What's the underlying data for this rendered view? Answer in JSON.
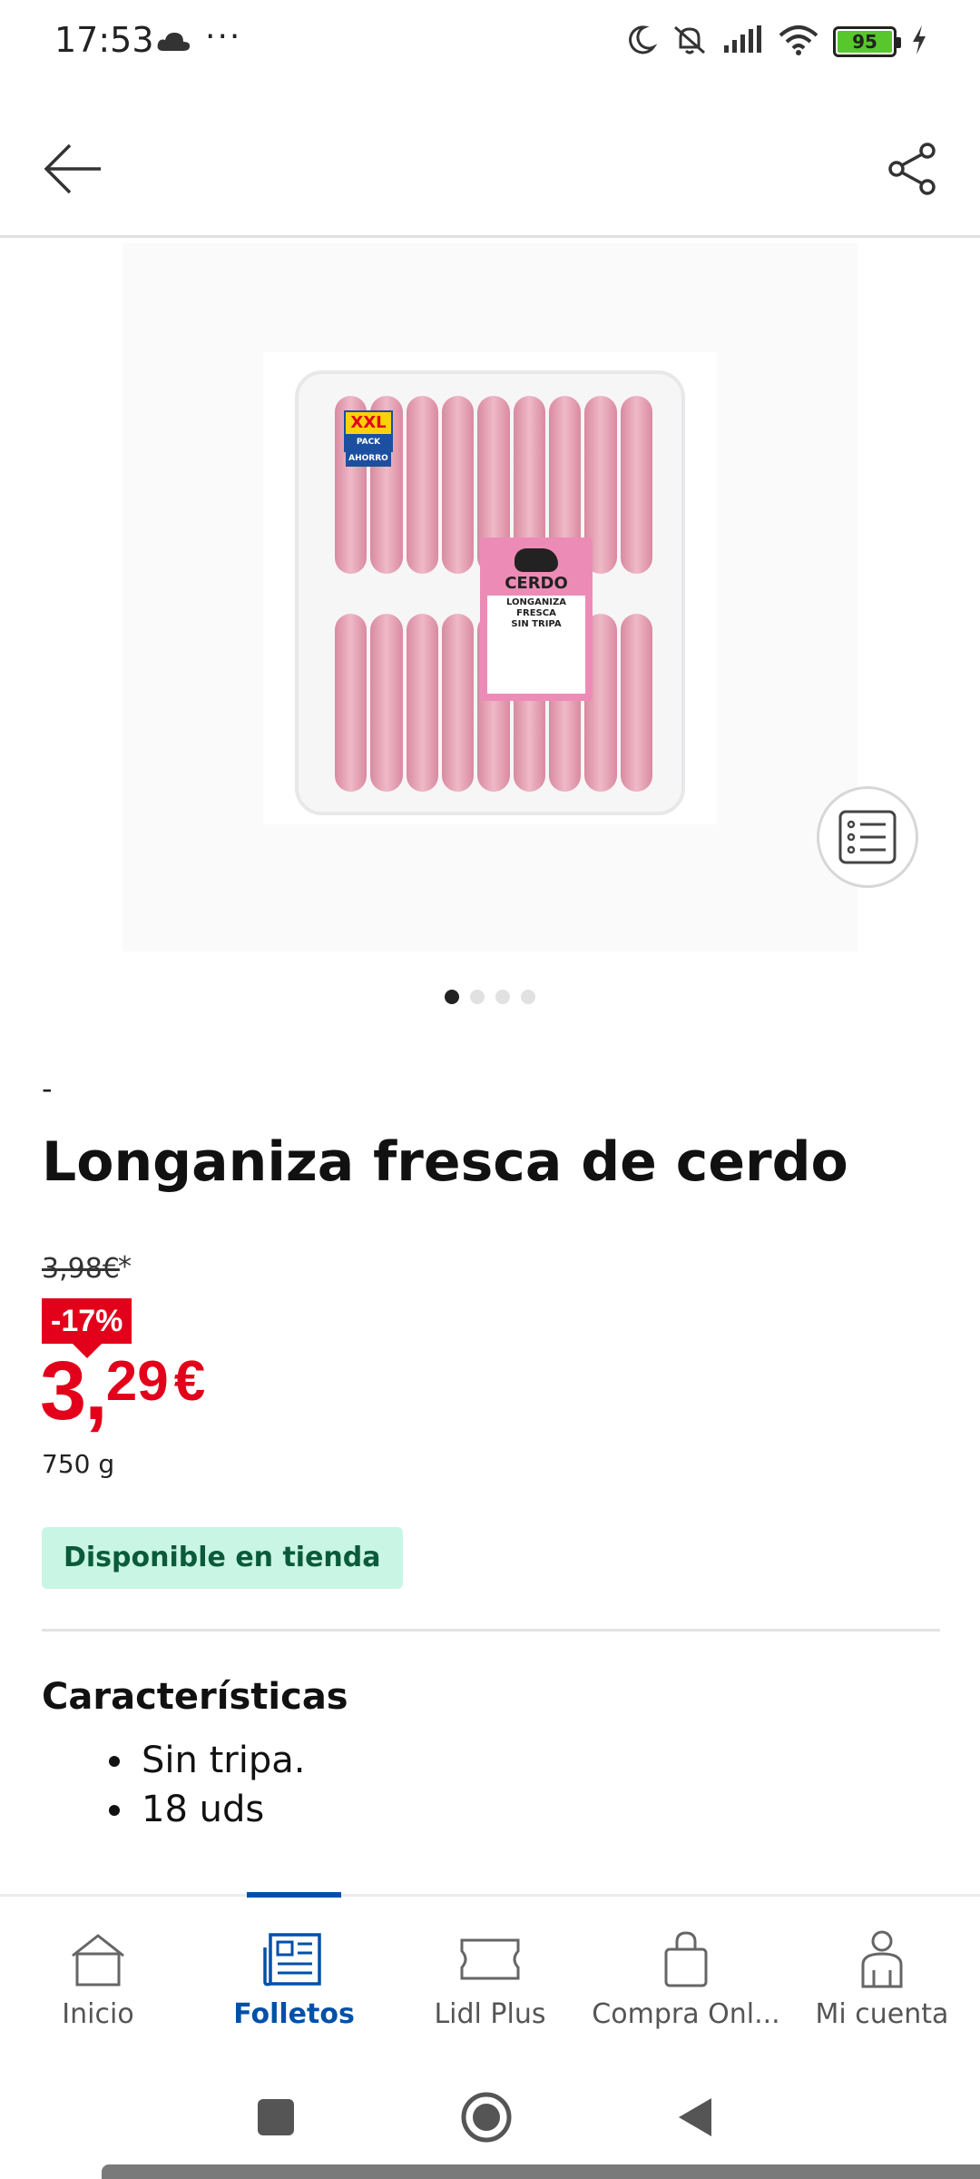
{
  "status_bar": {
    "time": "17:53",
    "dots": "···",
    "battery": "95",
    "icons": [
      "cloud-icon",
      "moon-icon",
      "bell-off-icon",
      "signal-icon",
      "wifi-icon",
      "battery-icon",
      "charging-icon"
    ],
    "battery_color": "#58c72c"
  },
  "header": {
    "back_icon": "arrow-left-icon",
    "share_icon": "share-icon"
  },
  "product_image": {
    "badge_xxl": "XXL",
    "badge_pack": "PACK AHORRO",
    "label_brand": "CERDO",
    "label_lines": [
      "LONGANIZA",
      "FRESCA",
      "SIN TRIPA"
    ],
    "checklist_icon": "checklist-icon",
    "carousel_total": 4,
    "carousel_active": 1
  },
  "product": {
    "brand": "-",
    "title": "Longaniza fresca de cerdo",
    "old_price": "3,98€",
    "old_price_note": "*",
    "discount": "-17%",
    "price_int": "3,",
    "price_dec": "29",
    "currency": "€",
    "weight": "750 g",
    "availability": "Disponible en tienda",
    "accent_color": "#e2001a"
  },
  "features": {
    "title": "Características",
    "items": [
      "Sin tripa.",
      "18 uds"
    ]
  },
  "bottom_nav": {
    "items": [
      {
        "label": "Inicio",
        "icon": "home-icon"
      },
      {
        "label": "Folletos",
        "icon": "newspaper-icon"
      },
      {
        "label": "Lidl Plus",
        "icon": "ticket-icon"
      },
      {
        "label": "Compra Onl...",
        "icon": "shopping-bag-icon"
      },
      {
        "label": "Mi cuenta",
        "icon": "user-icon"
      }
    ],
    "active": "Folletos",
    "active_color": "#0050aa"
  }
}
